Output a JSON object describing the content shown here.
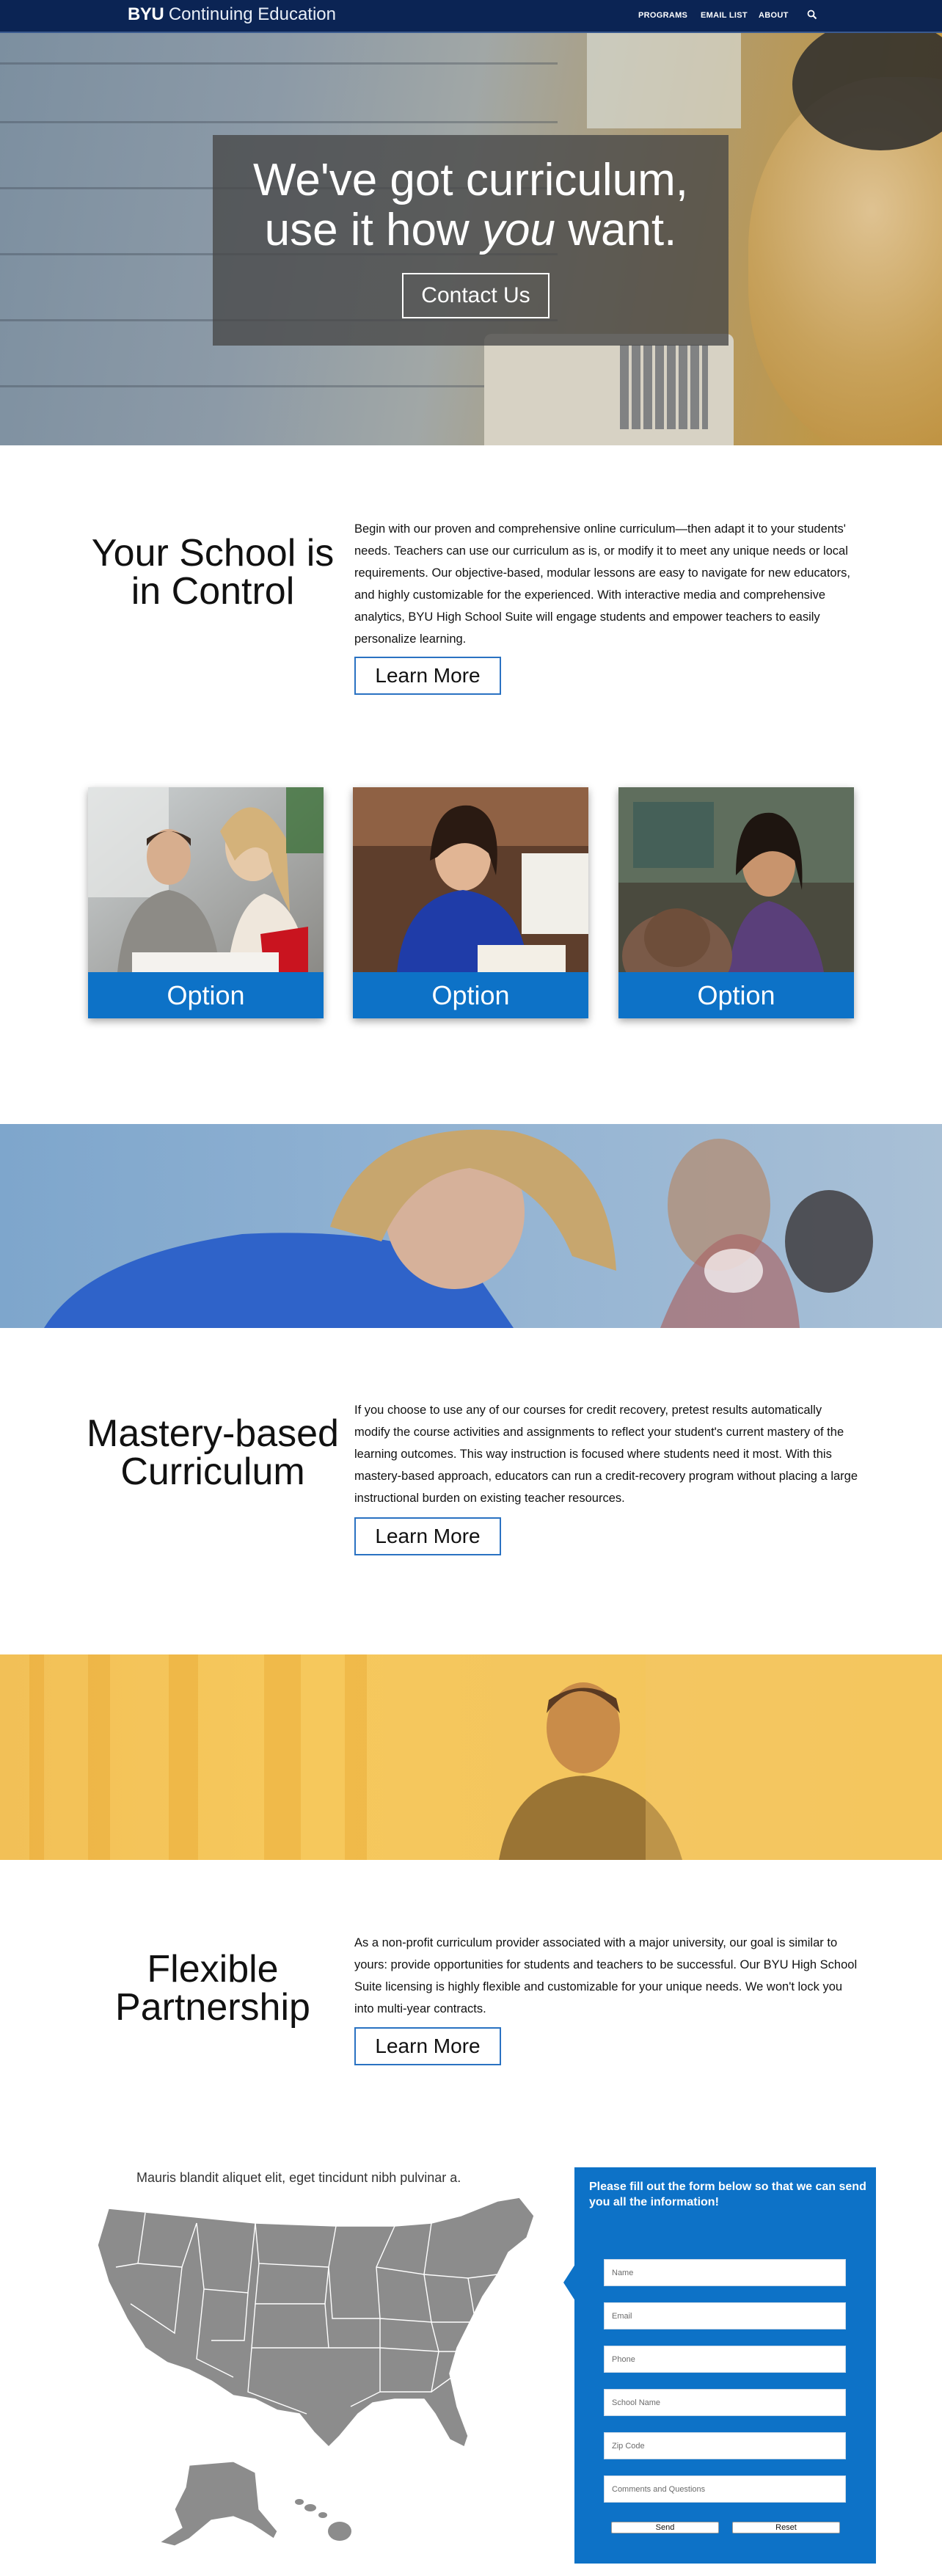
{
  "nav": {
    "brand_bold": "BYU",
    "brand_rest": " Continuing Education",
    "links": [
      "PROGRAMS",
      "EMAIL LIST",
      "ABOUT"
    ]
  },
  "hero": {
    "line1": "We've got curriculum,",
    "line2_pre": "use it how ",
    "line2_em": "you",
    "line2_post": " want.",
    "button": "Contact Us"
  },
  "section1": {
    "title_line1": "Your School is",
    "title_line2": "in Control",
    "body": "Begin with our proven and comprehensive online curriculum—then adapt it to your students' needs. Teachers can use our curriculum as is, or modify it to meet any unique needs or local requirements. Our objective-based, modular lessons are easy to navigate for new educators, and highly customizable for the experienced. With interactive media and comprehensive analytics, BYU High School Suite will engage students and empower teachers to easily personalize learning.",
    "button": "Learn More"
  },
  "options": [
    {
      "label": "Option"
    },
    {
      "label": "Option"
    },
    {
      "label": "Option"
    }
  ],
  "section2": {
    "title_line1": "Mastery-based",
    "title_line2": "Curriculum",
    "body": "If you choose to use any of our courses for credit recovery, pretest results automatically modify the course activities and assignments to reflect your student's current mastery of the learning outcomes. This way instruction is focused where students need it most. With this mastery-based approach, educators can run a credit-recovery program without placing a large instructional burden on existing teacher resources.",
    "button": "Learn More"
  },
  "section3": {
    "title_line1": "Flexible",
    "title_line2": "Partnership",
    "body": "As a non-profit curriculum provider associated with a major university, our goal is similar to yours: provide opportunities for students and teachers to be successful. Our BYU High School Suite licensing is highly flexible and customizable for your unique needs. We won't lock you into multi-year contracts.",
    "button": "Learn More"
  },
  "map": {
    "caption": "Mauris blandit aliquet elit, eget tincidunt nibh pulvinar a."
  },
  "form": {
    "heading": "Please fill out the form below so that we can send you all the information!",
    "placeholders": [
      "Name",
      "Email",
      "Phone",
      "School Name",
      "Zip Code",
      "Comments and Questions"
    ],
    "send": "Send",
    "reset": "Reset"
  },
  "colors": {
    "nav": "#0b2454",
    "accent_blue": "#0d72c7",
    "button_border": "#2a72c2",
    "banner_yellow": "#f4c65e"
  }
}
